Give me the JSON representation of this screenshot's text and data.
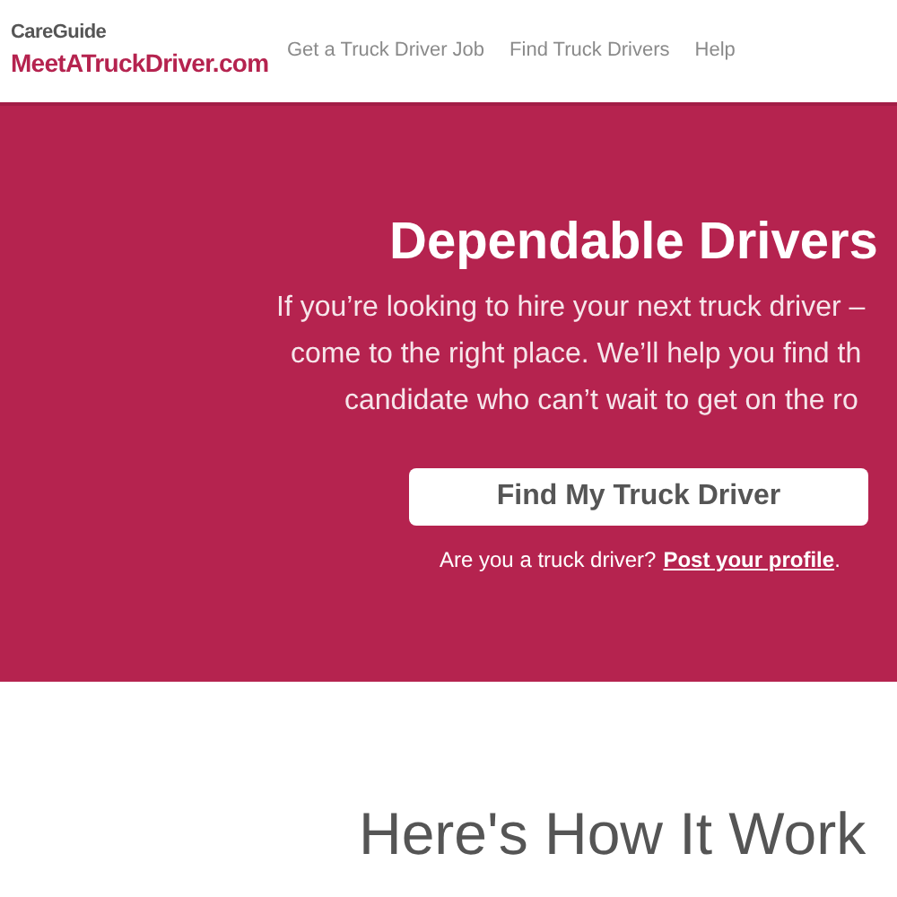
{
  "header": {
    "logo_top": "CareGuide",
    "logo_main": "MeetATruckDriver.com",
    "nav": [
      {
        "label": "Get a Truck Driver Job"
      },
      {
        "label": "Find Truck Drivers"
      },
      {
        "label": "Help"
      }
    ]
  },
  "hero": {
    "title": "Dependable Drivers",
    "lines": [
      "If you’re looking to hire your next truck driver –",
      "come to the right place. We’ll help you find th",
      "candidate who can’t wait to get on the ro"
    ],
    "button": "Find My Truck Driver",
    "question": "Are you a truck driver?",
    "link": "Post your profile",
    "after_link": "."
  },
  "section": {
    "title": "Here's How It Work"
  }
}
